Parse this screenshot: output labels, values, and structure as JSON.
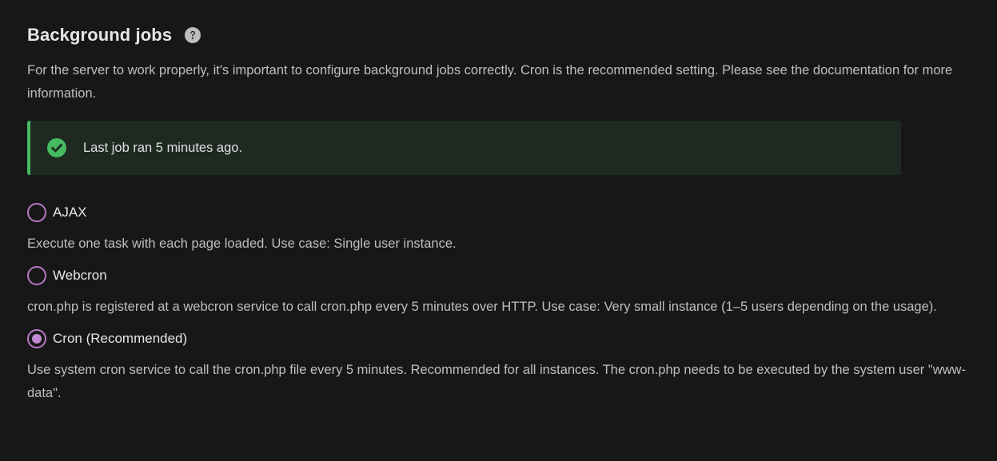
{
  "section": {
    "title": "Background jobs",
    "help_icon": "question-circle-icon",
    "description": "For the server to work properly, it's important to configure background jobs correctly. Cron is the recommended setting. Please see the documentation for more information."
  },
  "notice": {
    "icon": "check-circle-icon",
    "text": "Last job ran 5 minutes ago.",
    "accent_color": "#46ba61"
  },
  "options": [
    {
      "label": "AJAX",
      "description": "Execute one task with each page loaded. Use case: Single user instance.",
      "selected": false
    },
    {
      "label": "Webcron",
      "description": "cron.php is registered at a webcron service to call cron.php every 5 minutes over HTTP. Use case: Very small instance (1–5 users depending on the usage).",
      "selected": false
    },
    {
      "label": "Cron (Recommended)",
      "description": "Use system cron service to call the cron.php file every 5 minutes. Recommended for all instances. The cron.php needs to be executed by the system user \"www-data\".",
      "selected": true
    }
  ],
  "colors": {
    "background": "#171717",
    "radio_accent": "#b779c8",
    "success": "#46ba61"
  }
}
